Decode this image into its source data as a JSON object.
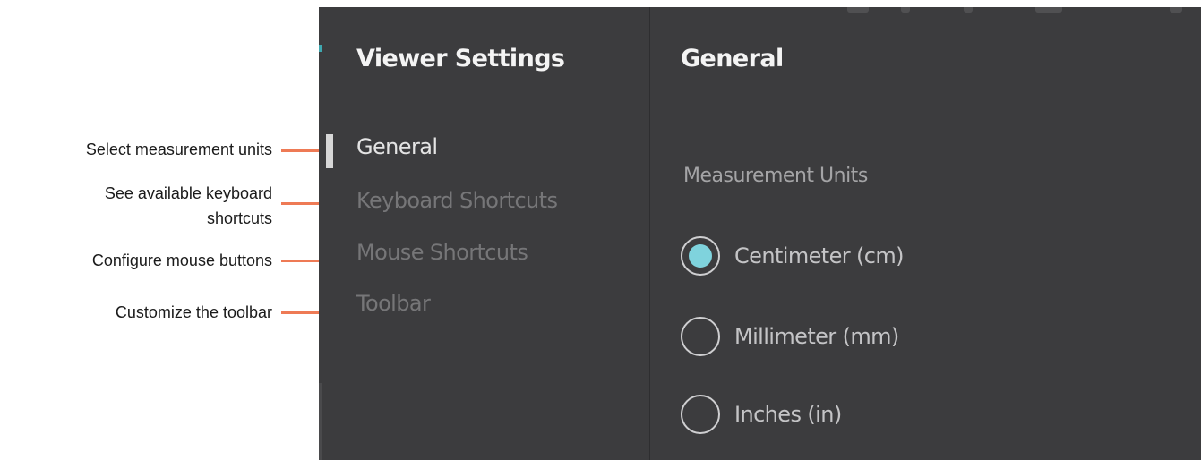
{
  "annotations": {
    "general": "Select measurement units",
    "keyboard_line1": "See available keyboard",
    "keyboard_line2": "shortcuts",
    "mouse": "Configure mouse buttons",
    "toolbar": "Customize the toolbar",
    "leader_color": "#ee7a55"
  },
  "sidebar": {
    "title": "Viewer Settings",
    "items": [
      {
        "label": "General",
        "active": true
      },
      {
        "label": "Keyboard Shortcuts",
        "active": false
      },
      {
        "label": "Mouse Shortcuts",
        "active": false
      },
      {
        "label": "Toolbar",
        "active": false
      }
    ]
  },
  "content": {
    "title": "General",
    "section_label": "Measurement Units",
    "options": [
      {
        "label": "Centimeter (cm)",
        "selected": true
      },
      {
        "label": "Millimeter (mm)",
        "selected": false
      },
      {
        "label": "Inches (in)",
        "selected": false
      }
    ]
  },
  "colors": {
    "panel_bg": "#3c3c3e",
    "accent": "#7fd3dd",
    "text_primary": "#f4f4f4",
    "text_muted": "#767678"
  }
}
